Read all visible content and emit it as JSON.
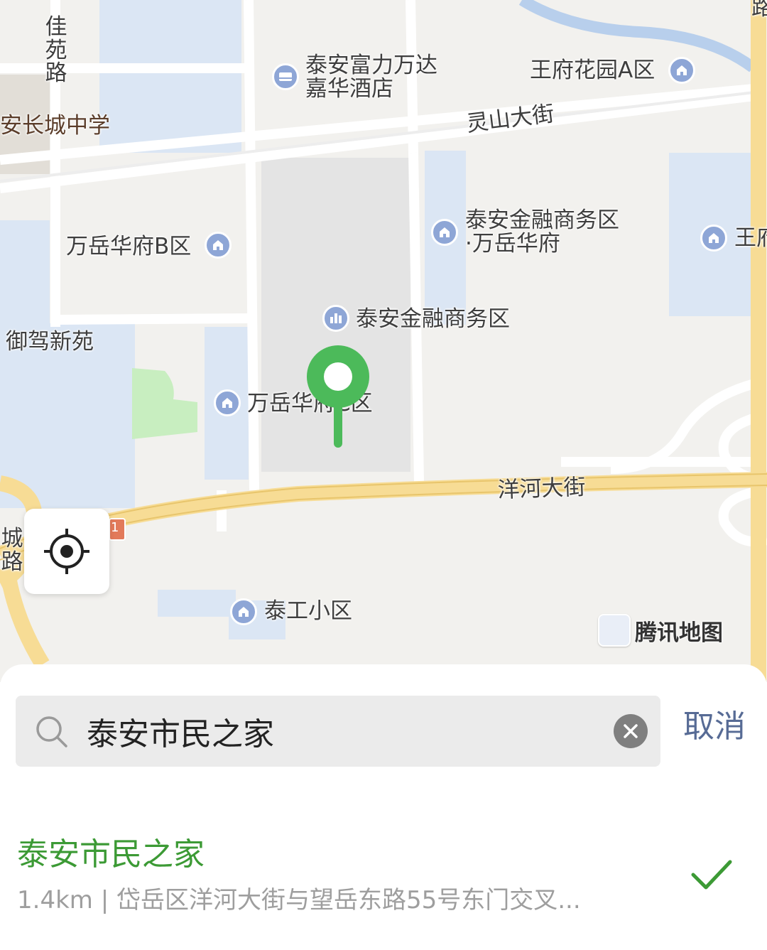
{
  "map": {
    "labels": {
      "jiayuan_road": "佳苑路",
      "hotel": "泰安富力万达\n嘉华酒店",
      "wangfu_a": "王府花园A区",
      "changcheng_school": "安长城中学",
      "lingshan_street": "灵山大街",
      "wanyue_b": "万岳华府B区",
      "finance_wanyue": "泰安金融商务区\n·万岳华府",
      "wangfu_edge": "王府",
      "finance_district": "泰安金融商务区",
      "yujia": "御驾新苑",
      "wanyue_c": "万岳华府C区",
      "yanghe_street": "洋河大街",
      "taigong": "泰工小区",
      "road_edge_left": "城路",
      "road_edge_top": "路",
      "shield": "1"
    },
    "brand": "腾讯地图",
    "icons": {
      "locate": "crosshair-icon",
      "pin": "map-pin-icon"
    },
    "colors": {
      "pin": "#4cba5a",
      "poi": "#8ea6d6",
      "water": "#dbe6f4",
      "major_road": "#f7dc95"
    }
  },
  "search": {
    "value": "泰安市民之家",
    "cancel_label": "取消"
  },
  "results": [
    {
      "name": "泰安市民之家",
      "detail": "1.4km | 岱岳区洋河大街与望岳东路55号东门交叉...",
      "selected": true
    }
  ],
  "colors": {
    "accent_green": "#3c9a35",
    "link_blue": "#576b95"
  }
}
